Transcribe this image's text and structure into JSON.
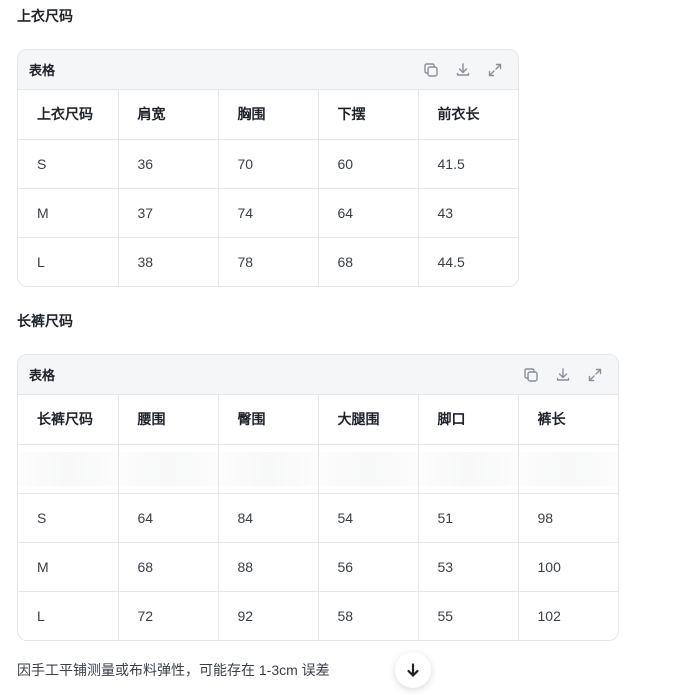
{
  "top": {
    "heading": "上衣尺码",
    "card_title": "表格",
    "headers": [
      "上衣尺码",
      "肩宽",
      "胸围",
      "下摆",
      "前衣长"
    ],
    "rows": [
      [
        "S",
        "36",
        "70",
        "60",
        "41.5"
      ],
      [
        "M",
        "37",
        "74",
        "64",
        "43"
      ],
      [
        "L",
        "38",
        "78",
        "68",
        "44.5"
      ]
    ]
  },
  "pants": {
    "heading": "长裤尺码",
    "card_title": "表格",
    "headers": [
      "长裤尺码",
      "腰围",
      "臀围",
      "大腿围",
      "脚口",
      "裤长"
    ],
    "rows": [
      [
        "S",
        "64",
        "84",
        "54",
        "51",
        "98"
      ],
      [
        "M",
        "68",
        "88",
        "56",
        "53",
        "100"
      ],
      [
        "L",
        "72",
        "92",
        "58",
        "55",
        "102"
      ]
    ]
  },
  "icons": {
    "copy": "copy-icon",
    "download": "download-icon",
    "expand": "expand-icon",
    "scroll": "arrow-down-icon"
  },
  "note": "因手工平铺测量或布料弹性，可能存在 1-3cm 误差"
}
